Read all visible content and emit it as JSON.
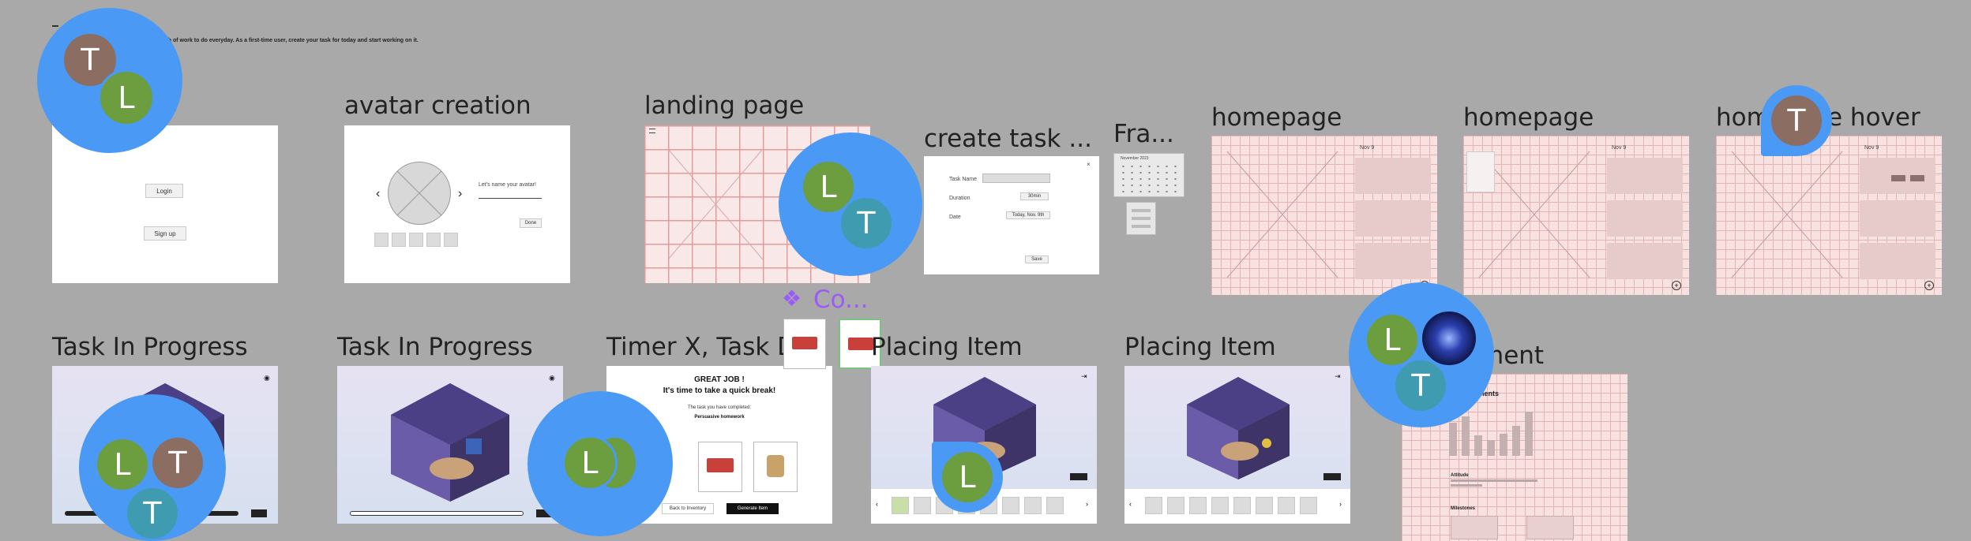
{
  "canvas": {
    "intro_text": "bunch of work to do everyday. As a first-time user, create your task for today and start working on it."
  },
  "frames": {
    "signup": {
      "title": "up",
      "login": "Login",
      "signup": "Sign up"
    },
    "avatar_creation": {
      "title": "avatar creation",
      "prompt": "Let's name your avatar!",
      "done": "Done"
    },
    "landing_page": {
      "title": "landing page"
    },
    "create_task": {
      "title": "create task ...",
      "task_name": "Task Name",
      "duration": "Duration",
      "date": "Date",
      "duration_value": "30min",
      "date_value": "Today, Nov. 9th",
      "save": "Save"
    },
    "fra": {
      "title": "Fra...",
      "month": "November 2023"
    },
    "homepage1": {
      "title": "homepage",
      "date": "Nov 9"
    },
    "homepage2": {
      "title": "homepage",
      "date": "Nov 9"
    },
    "homepage_hover": {
      "title_left": "hom",
      "title_right": "e hover",
      "date": "Nov 9"
    },
    "task_in_progress1": {
      "title": "Task In Progress"
    },
    "task_in_progress2": {
      "title": "Task In Progress"
    },
    "timer": {
      "title": "Timer X, Task D",
      "great_job": "GREAT JOB !",
      "break": "It's time to take a quick break!",
      "completed": "The task you have completed:",
      "task": "Persuasive homework",
      "back": "Back to Inventory",
      "generate": "Generate Item"
    },
    "component": {
      "label": "Co..."
    },
    "placing_item1": {
      "title": "Placing Item"
    },
    "placing_item2": {
      "title": "Placing Item"
    },
    "achievement": {
      "title": "ment",
      "heading": "Achievements",
      "section1": "Attitude",
      "section2": "Milestones"
    }
  },
  "avatars": {
    "t": "T",
    "l": "L"
  },
  "colors": {
    "cursor_blue": "#4a9af5",
    "avatar_t": "#8b6d62",
    "avatar_l": "#6c9d3e",
    "avatar_teal": "#3e9bb0",
    "component_purple": "#9b5cf6",
    "wireframe_red": "#e59a9a"
  }
}
